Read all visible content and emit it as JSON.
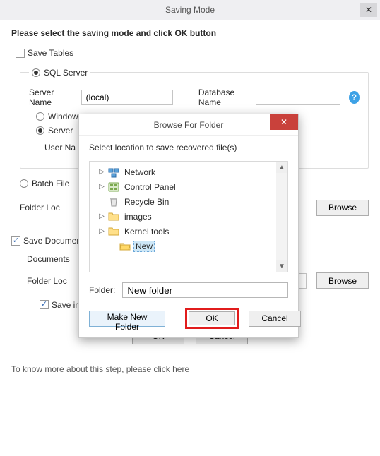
{
  "window": {
    "title": "Saving Mode"
  },
  "instr": "Please select the saving mode and click OK button",
  "saveTables": {
    "label": "Save Tables",
    "checked": false
  },
  "sql": {
    "legendLabel": "SQL Server",
    "serverNameLabel": "Server Name",
    "serverNameValue": "(local)",
    "databaseNameLabel": "Database Name",
    "databaseNameValue": "",
    "auth": {
      "windowsLabel": "Window",
      "serverLabel": "Server"
    },
    "userNameLabel": "User Na"
  },
  "batch": {
    "label": "Batch File",
    "folderLocLabel": "Folder Loc",
    "browseLabel": "Browse"
  },
  "docs": {
    "saveDocsCheckboxLabel": "Save Documen",
    "documentsLabel": "Documents",
    "folderLocLabel": "Folder Loc",
    "browseLabel": "Browse",
    "saveFullPathLabel": "Save in full path"
  },
  "mainButtons": {
    "ok": "OK",
    "cancel": "Cancel"
  },
  "learnMore": "To know more about this step, please click here",
  "modal": {
    "title": "Browse For Folder",
    "instruction": "Select location to save recovered file(s)",
    "tree": [
      {
        "icon": "network",
        "label": "Network",
        "expandable": true,
        "indent": 0
      },
      {
        "icon": "cpanel",
        "label": "Control Panel",
        "expandable": true,
        "indent": 0
      },
      {
        "icon": "recycle",
        "label": "Recycle Bin",
        "expandable": false,
        "indent": 0
      },
      {
        "icon": "folder",
        "label": "images",
        "expandable": true,
        "indent": 0
      },
      {
        "icon": "folder",
        "label": "Kernel tools",
        "expandable": true,
        "indent": 0
      },
      {
        "icon": "folder-open",
        "label": "New",
        "expandable": false,
        "indent": 1,
        "selected": true
      }
    ],
    "folderLabel": "Folder:",
    "folderValue": "New folder",
    "makeNew": "Make New Folder",
    "ok": "OK",
    "cancel": "Cancel"
  }
}
